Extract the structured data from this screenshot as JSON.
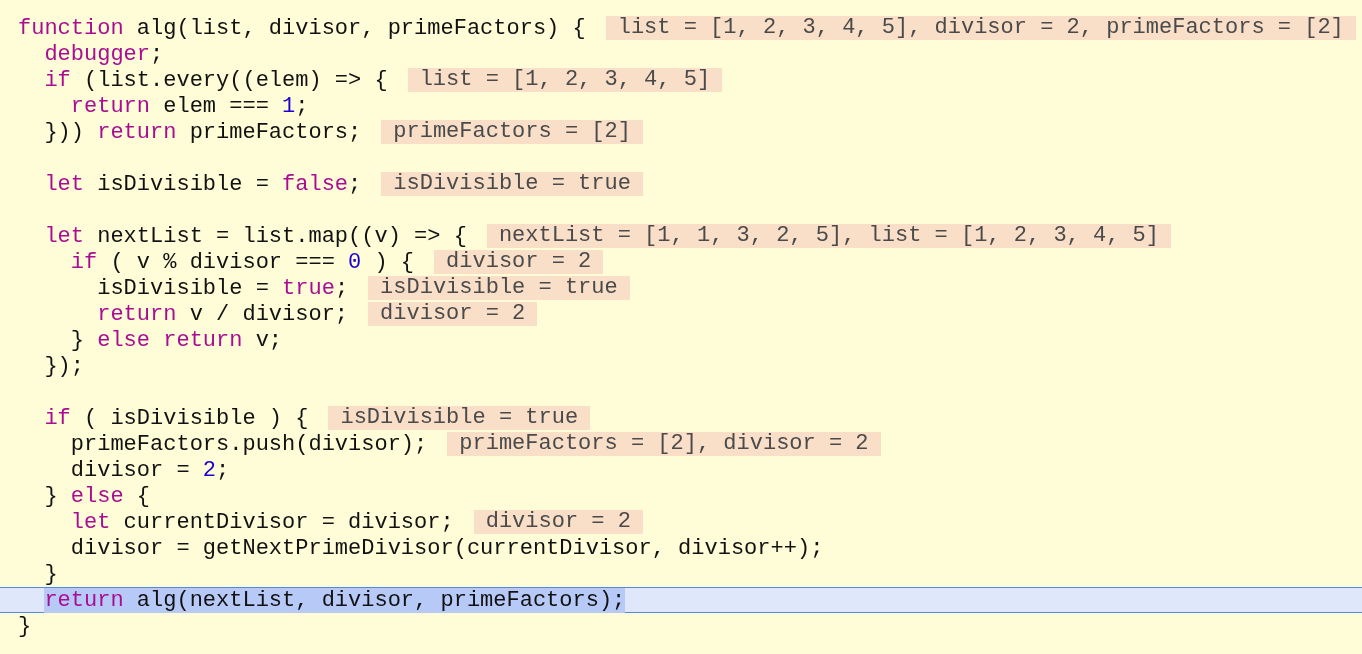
{
  "editor": {
    "lines": [
      {
        "tokens": [
          {
            "kind": "keyword",
            "text": "function"
          },
          {
            "kind": "plain",
            "text": " alg(list, divisor, primeFactors) {"
          }
        ],
        "annotation": "list = [1, 2, 3, 4, 5], divisor = 2, primeFactors = [2]",
        "current": false
      },
      {
        "tokens": [
          {
            "kind": "keyword",
            "text": "  debugger"
          },
          {
            "kind": "plain",
            "text": ";"
          }
        ],
        "current": false
      },
      {
        "tokens": [
          {
            "kind": "keyword",
            "text": "  if"
          },
          {
            "kind": "plain",
            "text": " (list.every((elem) => {"
          }
        ],
        "annotation": "list = [1, 2, 3, 4, 5]",
        "current": false
      },
      {
        "tokens": [
          {
            "kind": "keyword",
            "text": "    return"
          },
          {
            "kind": "plain",
            "text": " elem === "
          },
          {
            "kind": "number",
            "text": "1"
          },
          {
            "kind": "plain",
            "text": ";"
          }
        ],
        "current": false
      },
      {
        "tokens": [
          {
            "kind": "plain",
            "text": "  })) "
          },
          {
            "kind": "keyword",
            "text": "return"
          },
          {
            "kind": "plain",
            "text": " primeFactors;"
          }
        ],
        "annotation": "primeFactors = [2]",
        "current": false
      },
      {
        "current": false
      },
      {
        "tokens": [
          {
            "kind": "keyword",
            "text": "  let"
          },
          {
            "kind": "plain",
            "text": " isDivisible = "
          },
          {
            "kind": "keyword",
            "text": "false"
          },
          {
            "kind": "plain",
            "text": ";"
          }
        ],
        "annotation": "isDivisible = true",
        "current": false
      },
      {
        "current": false
      },
      {
        "tokens": [
          {
            "kind": "keyword",
            "text": "  let"
          },
          {
            "kind": "plain",
            "text": " nextList = list.map((v) => {"
          }
        ],
        "annotation": "nextList = [1, 1, 3, 2, 5], list = [1, 2, 3, 4, 5]",
        "current": false
      },
      {
        "tokens": [
          {
            "kind": "keyword",
            "text": "    if"
          },
          {
            "kind": "plain",
            "text": " ( v % divisor === "
          },
          {
            "kind": "number",
            "text": "0"
          },
          {
            "kind": "plain",
            "text": " ) {"
          }
        ],
        "annotation": "divisor = 2",
        "current": false
      },
      {
        "tokens": [
          {
            "kind": "plain",
            "text": "      isDivisible = "
          },
          {
            "kind": "keyword",
            "text": "true"
          },
          {
            "kind": "plain",
            "text": ";"
          }
        ],
        "annotation": "isDivisible = true",
        "current": false
      },
      {
        "tokens": [
          {
            "kind": "keyword",
            "text": "      return"
          },
          {
            "kind": "plain",
            "text": " v / divisor;"
          }
        ],
        "annotation": "divisor = 2",
        "current": false
      },
      {
        "tokens": [
          {
            "kind": "plain",
            "text": "    } "
          },
          {
            "kind": "keyword",
            "text": "else return"
          },
          {
            "kind": "plain",
            "text": " v;"
          }
        ],
        "current": false
      },
      {
        "tokens": [
          {
            "kind": "plain",
            "text": "  });"
          }
        ],
        "current": false
      },
      {
        "current": false
      },
      {
        "tokens": [
          {
            "kind": "keyword",
            "text": "  if"
          },
          {
            "kind": "plain",
            "text": " ( isDivisible ) {"
          }
        ],
        "annotation": "isDivisible = true",
        "current": false
      },
      {
        "tokens": [
          {
            "kind": "plain",
            "text": "    primeFactors.push(divisor);"
          }
        ],
        "annotation": "primeFactors = [2], divisor = 2",
        "current": false
      },
      {
        "tokens": [
          {
            "kind": "plain",
            "text": "    divisor = "
          },
          {
            "kind": "number",
            "text": "2"
          },
          {
            "kind": "plain",
            "text": ";"
          }
        ],
        "current": false
      },
      {
        "tokens": [
          {
            "kind": "plain",
            "text": "  } "
          },
          {
            "kind": "keyword",
            "text": "else"
          },
          {
            "kind": "plain",
            "text": " {"
          }
        ],
        "current": false
      },
      {
        "tokens": [
          {
            "kind": "keyword",
            "text": "    let"
          },
          {
            "kind": "plain",
            "text": " currentDivisor = divisor;"
          }
        ],
        "annotation": "divisor = 2",
        "current": false
      },
      {
        "tokens": [
          {
            "kind": "plain",
            "text": "    divisor = getNextPrimeDivisor(currentDivisor, divisor++);"
          }
        ],
        "current": false
      },
      {
        "tokens": [
          {
            "kind": "plain",
            "text": "  }"
          }
        ],
        "current": false
      },
      {
        "tokens": [
          {
            "kind": "keyword",
            "text": "  return"
          },
          {
            "kind": "plain",
            "text": " alg(nextList, divisor, primeFactors);"
          }
        ],
        "current": true
      },
      {
        "tokens": [
          {
            "kind": "plain",
            "text": "}"
          }
        ],
        "current": false
      }
    ]
  }
}
